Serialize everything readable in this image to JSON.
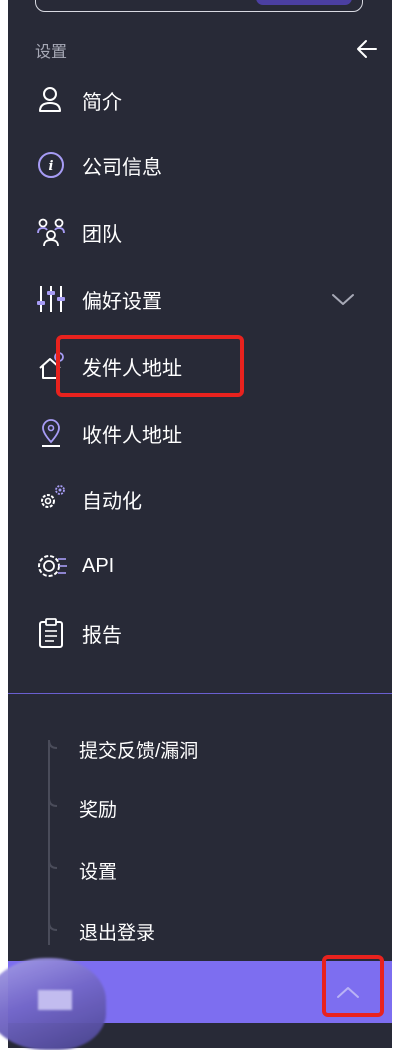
{
  "sidebar": {
    "section_label": "设置",
    "items": [
      {
        "label": "简介",
        "icon": "person-icon"
      },
      {
        "label": "公司信息",
        "icon": "info-icon"
      },
      {
        "label": "团队",
        "icon": "team-icon"
      },
      {
        "label": "偏好设置",
        "icon": "sliders-icon",
        "expanded": true
      },
      {
        "label": "发件人地址",
        "icon": "home-location-icon"
      },
      {
        "label": "收件人地址",
        "icon": "location-pin-icon"
      },
      {
        "label": "自动化",
        "icon": "gears-icon"
      },
      {
        "label": "API",
        "icon": "api-gear-icon"
      },
      {
        "label": "报告",
        "icon": "clipboard-icon"
      }
    ],
    "account_links": [
      "提交反馈/漏洞",
      "奖励",
      "设置",
      "退出登录"
    ]
  },
  "colors": {
    "sidebar_bg": "#282a37",
    "accent": "#7d6ef0",
    "annotation_red": "#e8221e"
  }
}
